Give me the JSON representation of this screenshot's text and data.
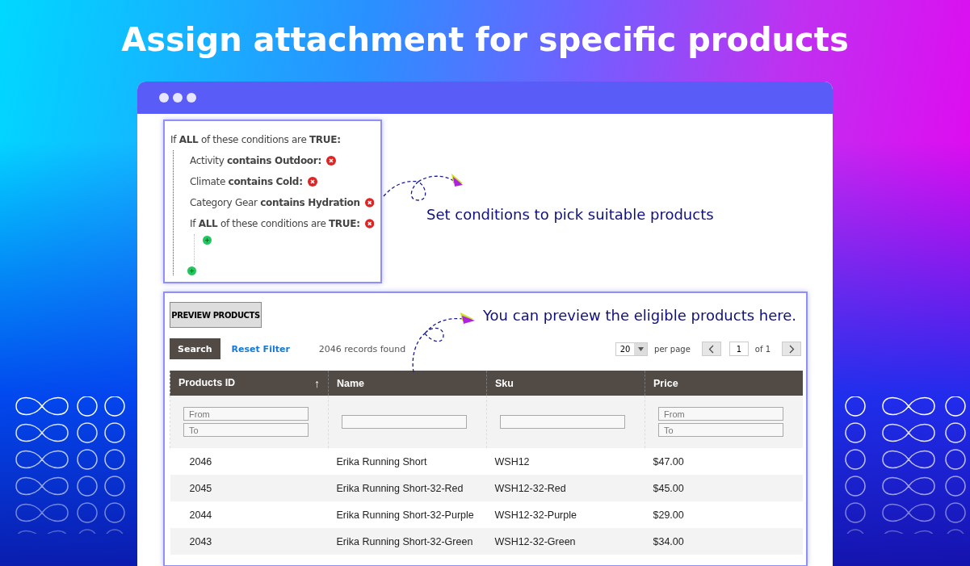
{
  "title": "Assign attachment for specific products",
  "conditions": {
    "header": "If **ALL** of these conditions are **TRUE:**",
    "items": [
      {
        "kind": "rule",
        "text": "Activity  **contains Outdoor:**"
      },
      {
        "kind": "rule",
        "text": "Climate **contains Cold:**"
      },
      {
        "kind": "rule",
        "text": "Category Gear **contains Hydration**"
      },
      {
        "kind": "group",
        "text": "If **ALL** of these conditions are **TRUE:**"
      }
    ]
  },
  "notes": [
    "Set conditions to pick suitable products",
    "You can preview the eligible products here."
  ],
  "products": {
    "preview_button": "PREVIEW PRODUCTS",
    "search_button": "Search",
    "reset_link": "Reset Filter",
    "records": "2046 records found",
    "per_page": "20",
    "per_page_label": "per page",
    "page": "1",
    "page_total": "of 1",
    "columns": [
      {
        "label": "Products ID",
        "sort": "↑",
        "filter": {
          "kind": "range",
          "fields": [
            {
              "placeholder": "From"
            },
            {
              "placeholder": "To"
            }
          ]
        }
      },
      {
        "label": "Name",
        "filter": {
          "kind": "text"
        }
      },
      {
        "label": "Sku",
        "filter": {
          "kind": "text"
        }
      },
      {
        "label": "Price",
        "filter": {
          "kind": "range",
          "fields": [
            {
              "placeholder": "From"
            },
            {
              "placeholder": "To"
            }
          ]
        }
      }
    ],
    "rows": [
      [
        "2046",
        "Erika Running Short",
        "WSH12",
        "$47.00"
      ],
      [
        "2045",
        "Erika Running Short-32-Red",
        "WSH12-32-Red",
        "$45.00"
      ],
      [
        "2044",
        "Erika Running Short-32-Purple",
        "WSH12-32-Purple",
        "$29.00"
      ],
      [
        "2043",
        "Erika Running Short-32-Green",
        "WSH12-32-Green",
        "$34.00"
      ]
    ]
  }
}
